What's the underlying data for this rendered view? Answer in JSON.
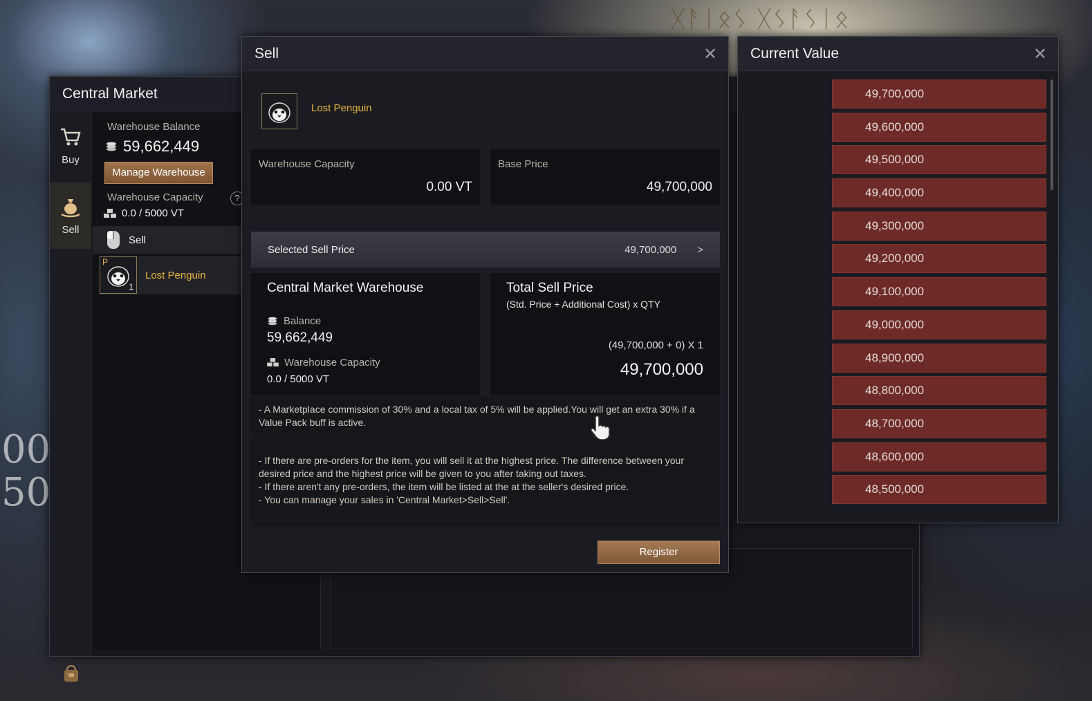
{
  "background": {
    "rune_text": "ᚷᚨᛁᛟᛊ ᚷᛊᚨᛊᛁᛟ",
    "numbers": [
      "00",
      "50"
    ]
  },
  "central_market": {
    "title": "Central Market",
    "nav": [
      {
        "label": "Buy",
        "icon": "cart-icon"
      },
      {
        "label": "Sell",
        "icon": "money-bag-icon"
      }
    ],
    "warehouse_balance_label": "Warehouse Balance",
    "warehouse_balance_value": "59,662,449",
    "manage_warehouse_label": "Manage Warehouse",
    "warehouse_capacity_label": "Warehouse Capacity",
    "warehouse_capacity_value": "0.0 / 5000 VT",
    "help_label": "?",
    "sell_tab_label": "Sell",
    "item": {
      "name": "Lost Penguin",
      "count": "1",
      "badge": "P"
    }
  },
  "sell_dialog": {
    "title": "Sell",
    "item_name": "Lost Penguin",
    "warehouse_capacity_label": "Warehouse Capacity",
    "warehouse_capacity_value": "0.00 VT",
    "base_price_label": "Base Price",
    "base_price_value": "49,700,000",
    "selected_sell_price_label": "Selected Sell Price",
    "selected_sell_price_value": "49,700,000",
    "selected_sell_price_arrow": ">",
    "cmw": {
      "title": "Central Market Warehouse",
      "balance_label": "Balance",
      "balance_value": "59,662,449",
      "capacity_label": "Warehouse Capacity",
      "capacity_value": "0.0 / 5000 VT"
    },
    "total": {
      "title": "Total Sell Price",
      "subtitle": "(Std. Price + Additional Cost) x QTY",
      "formula": "(49,700,000 + 0) X 1",
      "value": "49,700,000"
    },
    "notice_commission": "- A Marketplace commission of 30% and a local tax of 5% will be applied.You will get an extra 30% if a Value Pack buff is active.",
    "notice_lines": [
      "- If there are pre-orders for the item, you will sell it at the highest price. The difference between your desired price and the highest price will be given to you after taking out taxes.",
      "- If there aren't any pre-orders, the item will be listed at the at the seller's desired price.",
      "- You can manage your sales in 'Central Market>Sell>Sell'."
    ],
    "register_label": "Register"
  },
  "current_value": {
    "title": "Current Value",
    "prices": [
      "49,700,000",
      "49,600,000",
      "49,500,000",
      "49,400,000",
      "49,300,000",
      "49,200,000",
      "49,100,000",
      "49,000,000",
      "48,900,000",
      "48,800,000",
      "48,700,000",
      "48,600,000",
      "48,500,000"
    ]
  },
  "close_symbol": "✕",
  "colors": {
    "accent_gold": "#e8b43a",
    "button_brown": "#8f6440",
    "price_red": "#6e2a26"
  }
}
